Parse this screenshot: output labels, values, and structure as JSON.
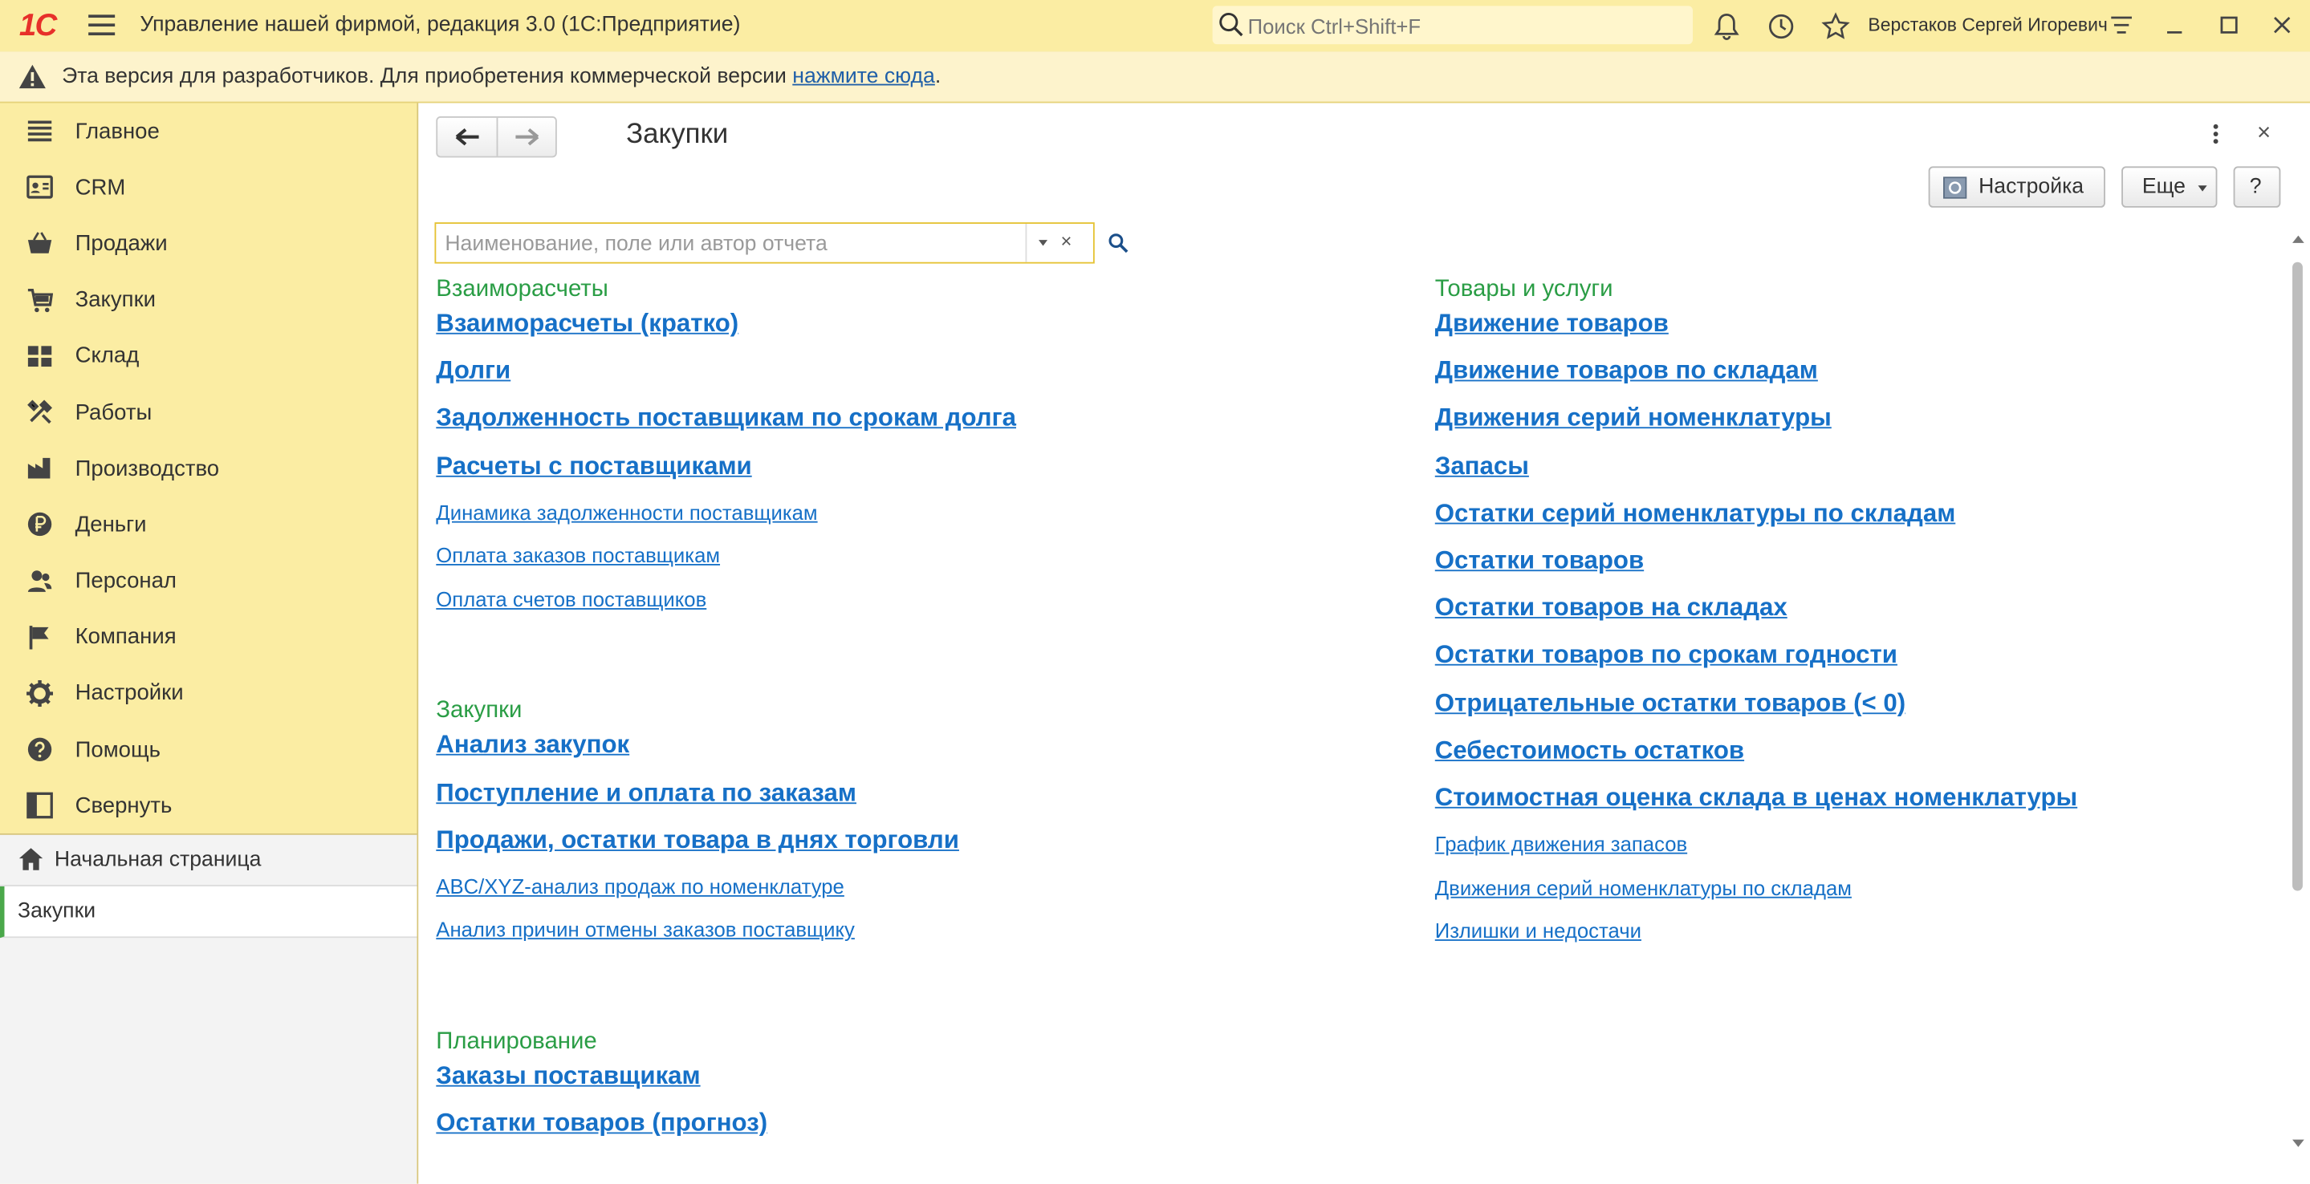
{
  "titlebar": {
    "logo": "1С",
    "title": "Управление нашей фирмой, редакция 3.0  (1С:Предприятие)",
    "search_placeholder": "Поиск Ctrl+Shift+F",
    "user": "Верстаков Сергей Игоревич"
  },
  "warning": {
    "text": "Эта версия для разработчиков. Для приобретения коммерческой версии ",
    "link": "нажмите сюда",
    "suffix": "."
  },
  "sidebar": {
    "items": [
      {
        "label": "Главное",
        "icon": "menu-icon"
      },
      {
        "label": "CRM",
        "icon": "contact-card-icon"
      },
      {
        "label": "Продажи",
        "icon": "basket-icon"
      },
      {
        "label": "Закупки",
        "icon": "cart-icon"
      },
      {
        "label": "Склад",
        "icon": "warehouse-icon"
      },
      {
        "label": "Работы",
        "icon": "tools-icon"
      },
      {
        "label": "Производство",
        "icon": "factory-icon"
      },
      {
        "label": "Деньги",
        "icon": "ruble-icon"
      },
      {
        "label": "Персонал",
        "icon": "people-icon"
      },
      {
        "label": "Компания",
        "icon": "flag-icon"
      },
      {
        "label": "Настройки",
        "icon": "gear-icon"
      },
      {
        "label": "Помощь",
        "icon": "help-icon"
      },
      {
        "label": "Свернуть",
        "icon": "collapse-icon"
      }
    ],
    "open_windows": [
      {
        "label": "Начальная страница"
      },
      {
        "label": "Закупки"
      }
    ]
  },
  "form": {
    "title": "Закупки",
    "settings_label": "Настройка",
    "more_label": "Еще",
    "help_label": "?",
    "close_label": "×",
    "search_placeholder": "Наименование, поле или автор отчета",
    "search_clear": "×"
  },
  "left_column": [
    {
      "group": "Взаиморасчеты",
      "main": [
        "Взаиморасчеты (кратко)",
        "Долги",
        "Задолженность поставщикам по срокам долга",
        "Расчеты с поставщиками"
      ],
      "other": [
        "Динамика задолженности поставщикам",
        "Оплата заказов поставщикам",
        "Оплата счетов поставщиков"
      ]
    },
    {
      "group": "Закупки",
      "main": [
        "Анализ закупок",
        "Поступление и оплата по заказам",
        "Продажи, остатки товара в днях торговли"
      ],
      "other": [
        "ABC/XYZ-анализ продаж по номенклатуре",
        "Анализ причин отмены заказов поставщику"
      ]
    },
    {
      "group": "Планирование",
      "main": [
        "Заказы поставщикам",
        "Остатки товаров (прогноз)"
      ],
      "other": []
    }
  ],
  "right_column": [
    {
      "group": "Товары и услуги",
      "main": [
        "Движение товаров",
        "Движение товаров по складам",
        "Движения серий номенклатуры",
        "Запасы",
        "Остатки серий номенклатуры по складам",
        "Остатки товаров",
        "Остатки товаров на складах",
        "Остатки товаров по срокам годности",
        "Отрицательные остатки товаров (< 0)",
        "Себестоимость остатков",
        "Стоимостная оценка склада в ценах номенклатуры"
      ],
      "other": [
        "График движения запасов",
        "Движения серий номенклатуры по складам",
        "Излишки и недостачи"
      ]
    }
  ],
  "colors": {
    "panel": "#fbeda3",
    "group": "#2a9d45",
    "link": "#1670c7",
    "logo": "#e7302a"
  }
}
